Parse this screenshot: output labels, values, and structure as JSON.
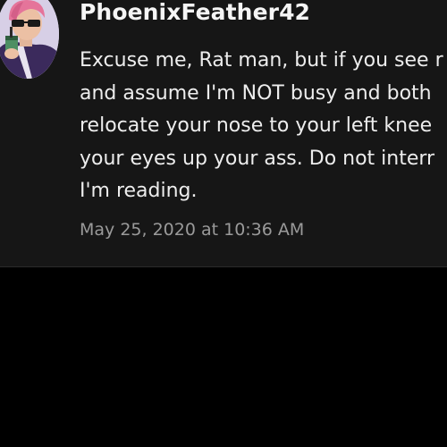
{
  "comment": {
    "username": "PhoenixFeather42",
    "avatar_icon": "cartoon-avatar-with-sunglasses-and-drink",
    "body_lines": [
      "Excuse me, Rat man, but if you see r",
      "and assume I'm NOT busy and both",
      "relocate your nose to your left knee",
      "your eyes up your ass. Do not interr",
      "I'm reading."
    ],
    "timestamp": "May 25, 2020 at 10:36 AM"
  },
  "colors": {
    "card_background": "#161616",
    "page_background": "#000000",
    "username_text": "#f5f5f5",
    "body_text": "#ededed",
    "timestamp_text": "#9a9a9a"
  }
}
